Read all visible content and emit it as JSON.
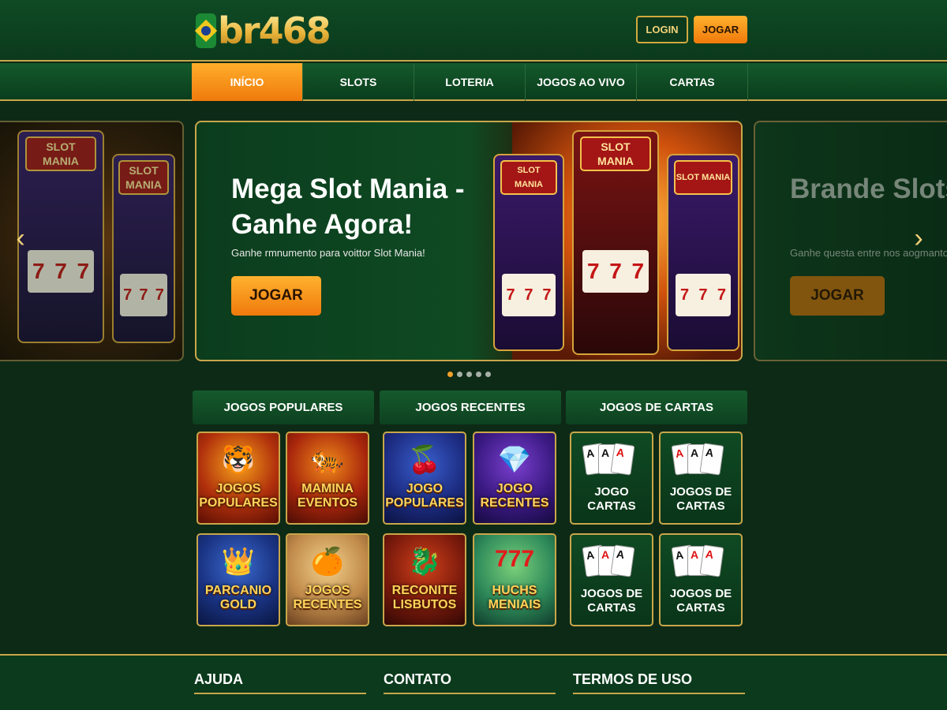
{
  "header": {
    "logo_text": "br468",
    "login_label": "LOGIN",
    "jogar_label": "JOGAR"
  },
  "nav": {
    "items": [
      {
        "label": "INÍCIO",
        "active": true
      },
      {
        "label": "SLOTS"
      },
      {
        "label": "LOTERIA"
      },
      {
        "label": "JOGOS AO VIVO"
      },
      {
        "label": "CARTAS"
      }
    ]
  },
  "hero": {
    "left_slide": {
      "sign_top": "SLOT MANIA",
      "sign_small": "SLOT MANIA"
    },
    "main": {
      "title": "Mega Slot Mania - Ganhe Agora!",
      "subtitle": "Ganhe rmnumento para voittor Slot Mania!",
      "button": "JOGAR",
      "machines": [
        "SLOT MANIA",
        "SLOT MANIA",
        "SLOT MANIA"
      ]
    },
    "right_slide": {
      "title": "Brande Slots Contau Cobu",
      "subtitle": "Ganhe questa entre nos aogmanto",
      "button": "JOGAR"
    },
    "prev_icon": "chevron-left-icon",
    "next_icon": "chevron-right-icon",
    "dots": 5,
    "active_dot": 0
  },
  "sections": [
    {
      "title": "JOGOS POPULARES",
      "games": [
        "JOGOS POPULARES",
        "MAMINA EVENTOS",
        "PARCANIO GOLD",
        "JOGOS RECENTES"
      ]
    },
    {
      "title": "JOGOS RECENTES",
      "games": [
        "JOGO POPULARES",
        "JOGO RECENTES",
        "RECONITE LISBUTOS",
        "HUCHS MENIAIS"
      ]
    },
    {
      "title": "JOGOS DE CARTAS",
      "games": [
        "JOGO CARTAS",
        "JOGOS DE CARTAS",
        "JOGOS DE CARTAS",
        "JOGOS DE CARTAS"
      ]
    }
  ],
  "footer": {
    "columns": [
      "AJUDA",
      "CONTATO",
      "TERMOS DE USO"
    ]
  },
  "colors": {
    "background": "#0d2a16",
    "accent_gold": "#c9a64a",
    "accent_orange": "#f07a0a"
  }
}
